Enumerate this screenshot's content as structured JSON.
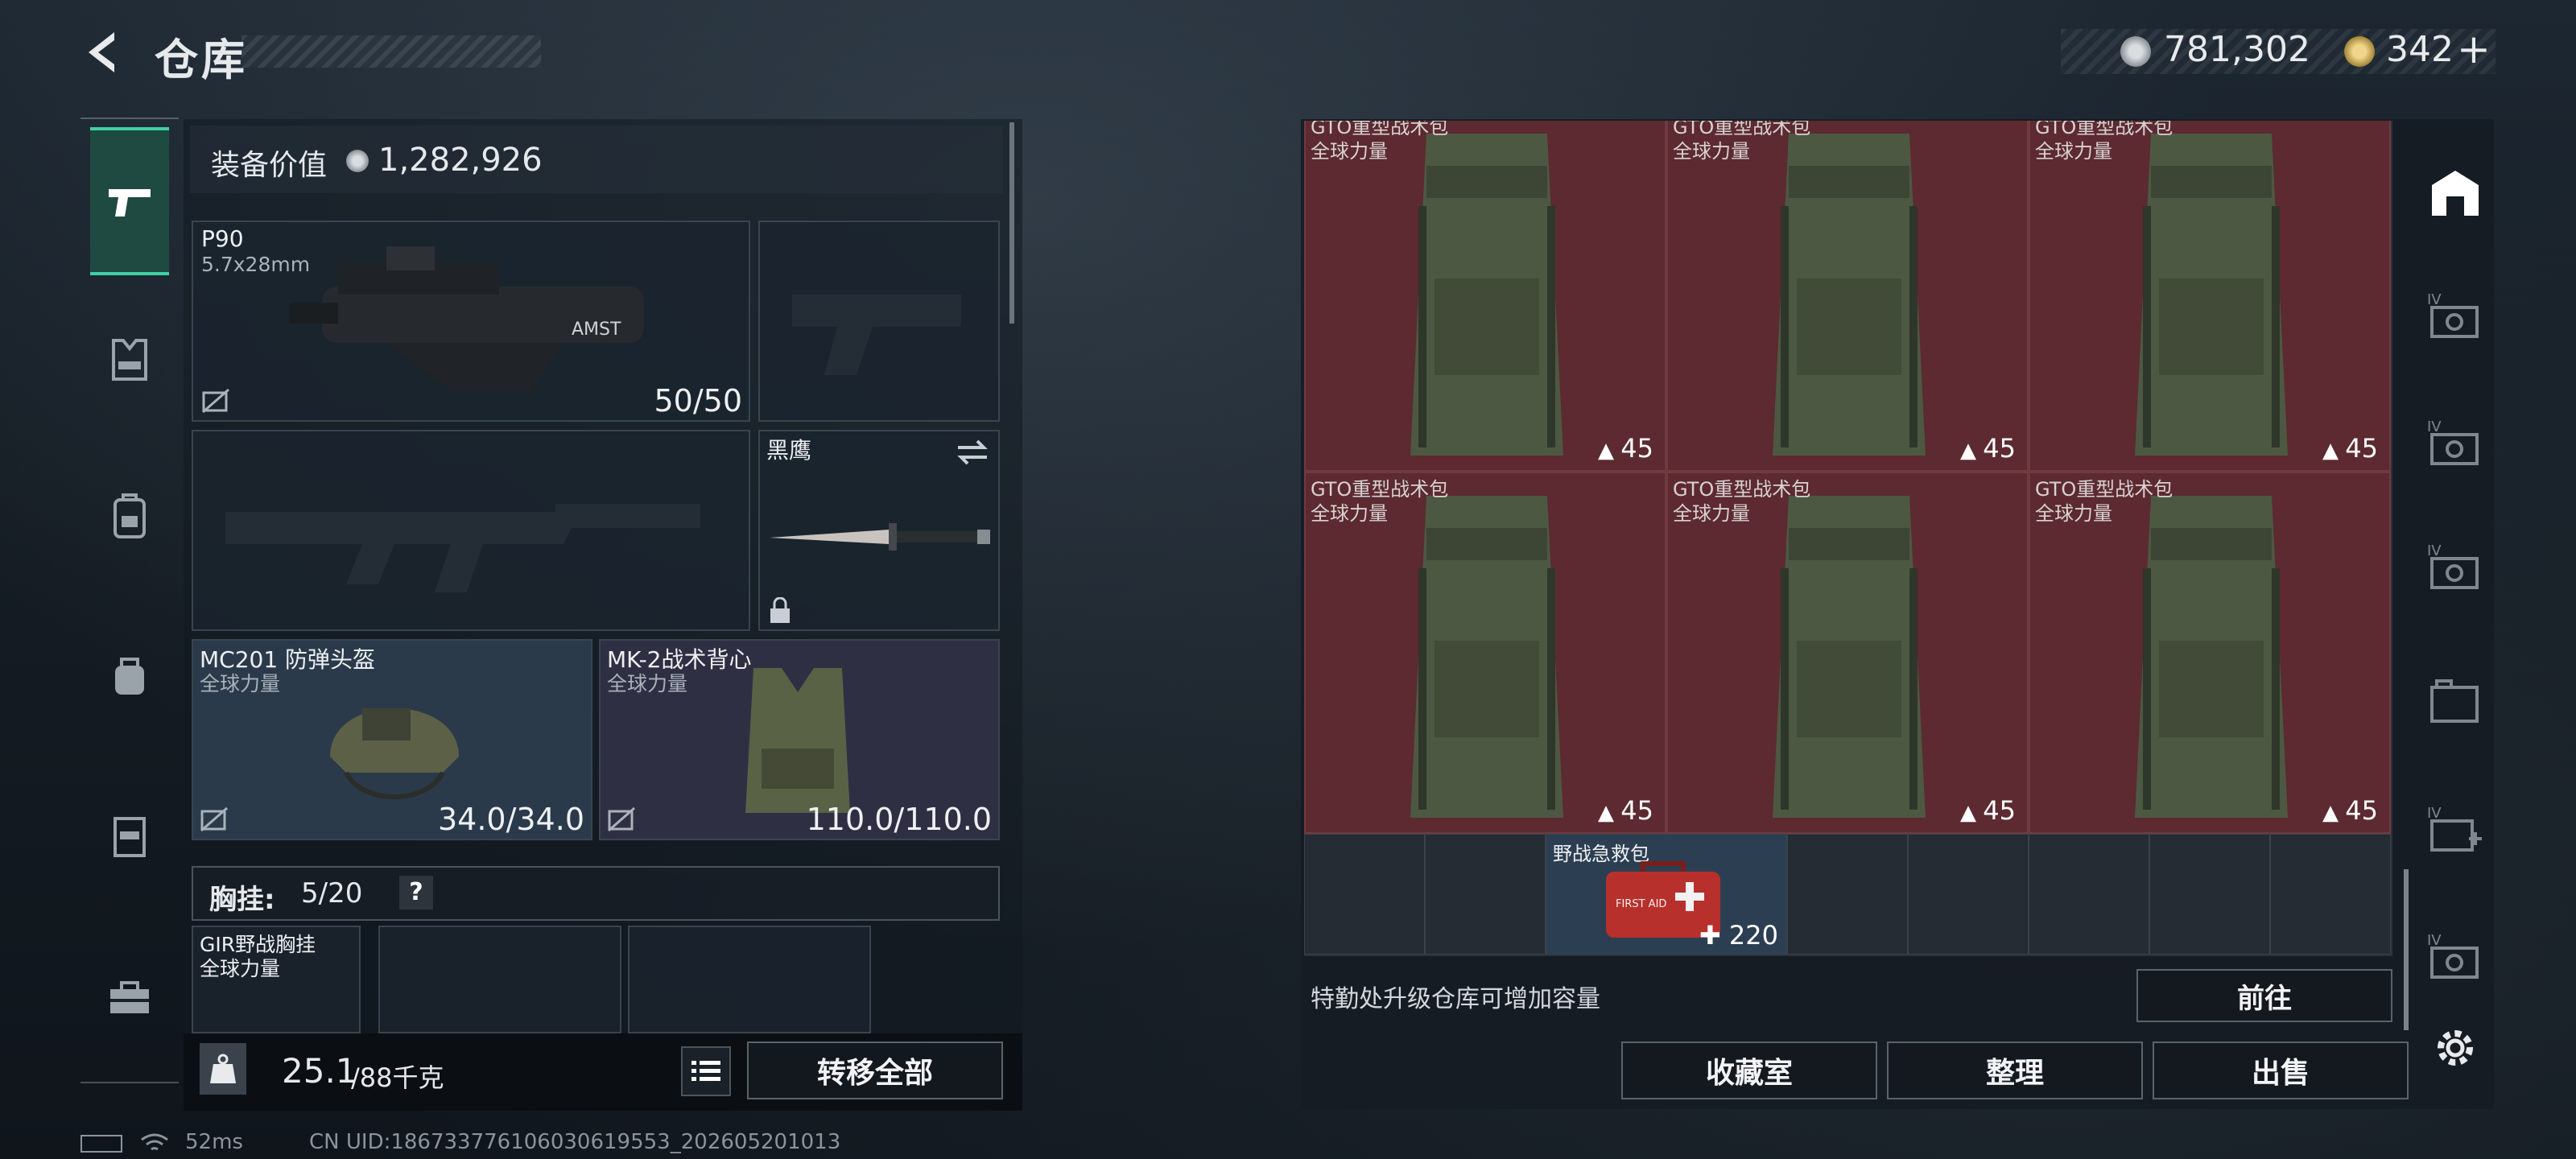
{
  "header": {
    "title": "仓库",
    "back_icon": "back-arrow-icon",
    "currency_silver": "781,302",
    "currency_gold": "342",
    "currency_gold_plus": "+"
  },
  "sidebar": {
    "items": [
      {
        "icon": "pistol-icon",
        "active": true
      },
      {
        "icon": "vest-icon",
        "active": false
      },
      {
        "icon": "backpack-icon",
        "active": false
      },
      {
        "icon": "bag-icon",
        "active": false
      },
      {
        "icon": "locker-icon",
        "active": false
      },
      {
        "icon": "toolbox-icon",
        "active": false
      }
    ]
  },
  "loadout": {
    "value_label": "装备价值",
    "value": "1,282,926",
    "primary": {
      "name": "P90",
      "ammo_type": "5.7x28mm",
      "ammo": "50/50"
    },
    "melee": {
      "name": "黑鹰"
    },
    "helmet": {
      "name": "MC201 防弹头盔",
      "source": "全球力量",
      "durability": "34.0/34.0"
    },
    "armor": {
      "name": "MK-2战术背心",
      "source": "全球力量",
      "durability": "110.0/110.0"
    },
    "chest_rig": {
      "label": "胸挂:",
      "count": "5/20",
      "help": "?"
    },
    "rig_item": {
      "name": "GIR野战胸挂",
      "source": "全球力量"
    },
    "weight": "25.1",
    "weight_max": "/88千克",
    "transfer_all": "转移全部"
  },
  "storage": {
    "items": [
      {
        "name": "GTO重型战术包",
        "source": "全球力量",
        "count": "45"
      },
      {
        "name": "GTO重型战术包",
        "source": "全球力量",
        "count": "45"
      },
      {
        "name": "GTO重型战术包",
        "source": "全球力量",
        "count": "45"
      },
      {
        "name": "GTO重型战术包",
        "source": "全球力量",
        "count": "45"
      },
      {
        "name": "GTO重型战术包",
        "source": "全球力量",
        "count": "45"
      },
      {
        "name": "GTO重型战术包",
        "source": "全球力量",
        "count": "45"
      }
    ],
    "medkit": {
      "name": "野战急救包",
      "count": "220",
      "label": "FIRST AID"
    },
    "upgrade_hint": "特勤处升级仓库可增加容量",
    "goto": "前往",
    "collection": "收藏室",
    "arrange": "整理",
    "sell": "出售"
  },
  "right_tabs": [
    {
      "icon": "warehouse-icon",
      "active": true
    },
    {
      "icon": "storage-iv-icon-1",
      "label": "IV"
    },
    {
      "icon": "storage-iv-icon-2",
      "label": "IV"
    },
    {
      "icon": "storage-iv-icon-3",
      "label": "IV"
    },
    {
      "icon": "storage-folder-icon"
    },
    {
      "icon": "storage-add-iv-icon",
      "label": "IV"
    },
    {
      "icon": "storage-iv-icon-4",
      "label": "IV"
    },
    {
      "icon": "settings-gear-icon"
    }
  ],
  "status": {
    "ping": "52ms",
    "uid": "CN UID:18673377610603061955​3_202605201013"
  }
}
